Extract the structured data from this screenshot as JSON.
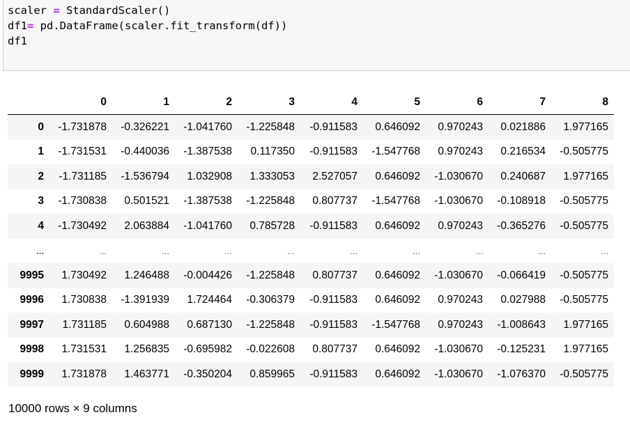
{
  "code_cell": {
    "lines": [
      {
        "parts": [
          {
            "text": "scaler ",
            "cls": "plain"
          },
          {
            "text": "=",
            "cls": "op"
          },
          {
            "text": " StandardScaler()",
            "cls": "plain"
          }
        ]
      },
      {
        "parts": [
          {
            "text": "df1",
            "cls": "plain"
          },
          {
            "text": "=",
            "cls": "op"
          },
          {
            "text": " pd.DataFrame(scaler.fit_transform(df))",
            "cls": "plain"
          }
        ]
      },
      {
        "parts": [
          {
            "text": "df1",
            "cls": "plain"
          }
        ]
      }
    ]
  },
  "dataframe": {
    "columns": [
      "0",
      "1",
      "2",
      "3",
      "4",
      "5",
      "6",
      "7",
      "8"
    ],
    "rows": [
      {
        "index": "0",
        "values": [
          "-1.731878",
          "-0.326221",
          "-1.041760",
          "-1.225848",
          "-0.911583",
          "0.646092",
          "0.970243",
          "0.021886",
          "1.977165"
        ]
      },
      {
        "index": "1",
        "values": [
          "-1.731531",
          "-0.440036",
          "-1.387538",
          "0.117350",
          "-0.911583",
          "-1.547768",
          "0.970243",
          "0.216534",
          "-0.505775"
        ]
      },
      {
        "index": "2",
        "values": [
          "-1.731185",
          "-1.536794",
          "1.032908",
          "1.333053",
          "2.527057",
          "0.646092",
          "-1.030670",
          "0.240687",
          "1.977165"
        ]
      },
      {
        "index": "3",
        "values": [
          "-1.730838",
          "0.501521",
          "-1.387538",
          "-1.225848",
          "0.807737",
          "-1.547768",
          "-1.030670",
          "-0.108918",
          "-0.505775"
        ]
      },
      {
        "index": "4",
        "values": [
          "-1.730492",
          "2.063884",
          "-1.041760",
          "0.785728",
          "-0.911583",
          "0.646092",
          "0.970243",
          "-0.365276",
          "-0.505775"
        ]
      },
      {
        "index": "...",
        "values": [
          "...",
          "...",
          "...",
          "...",
          "...",
          "...",
          "...",
          "...",
          "..."
        ],
        "ellipsis": true
      },
      {
        "index": "9995",
        "values": [
          "1.730492",
          "1.246488",
          "-0.004426",
          "-1.225848",
          "0.807737",
          "0.646092",
          "-1.030670",
          "-0.066419",
          "-0.505775"
        ]
      },
      {
        "index": "9996",
        "values": [
          "1.730838",
          "-1.391939",
          "1.724464",
          "-0.306379",
          "-0.911583",
          "0.646092",
          "0.970243",
          "0.027988",
          "-0.505775"
        ]
      },
      {
        "index": "9997",
        "values": [
          "1.731185",
          "0.604988",
          "0.687130",
          "-1.225848",
          "-0.911583",
          "-1.547768",
          "0.970243",
          "-1.008643",
          "1.977165"
        ]
      },
      {
        "index": "9998",
        "values": [
          "1.731531",
          "1.256835",
          "-0.695982",
          "-0.022608",
          "0.807737",
          "0.646092",
          "-1.030670",
          "-0.125231",
          "1.977165"
        ]
      },
      {
        "index": "9999",
        "values": [
          "1.731878",
          "1.463771",
          "-0.350204",
          "0.859965",
          "-0.911583",
          "0.646092",
          "-1.030670",
          "-1.076370",
          "-0.505775"
        ]
      }
    ],
    "summary": "10000 rows × 9 columns"
  }
}
